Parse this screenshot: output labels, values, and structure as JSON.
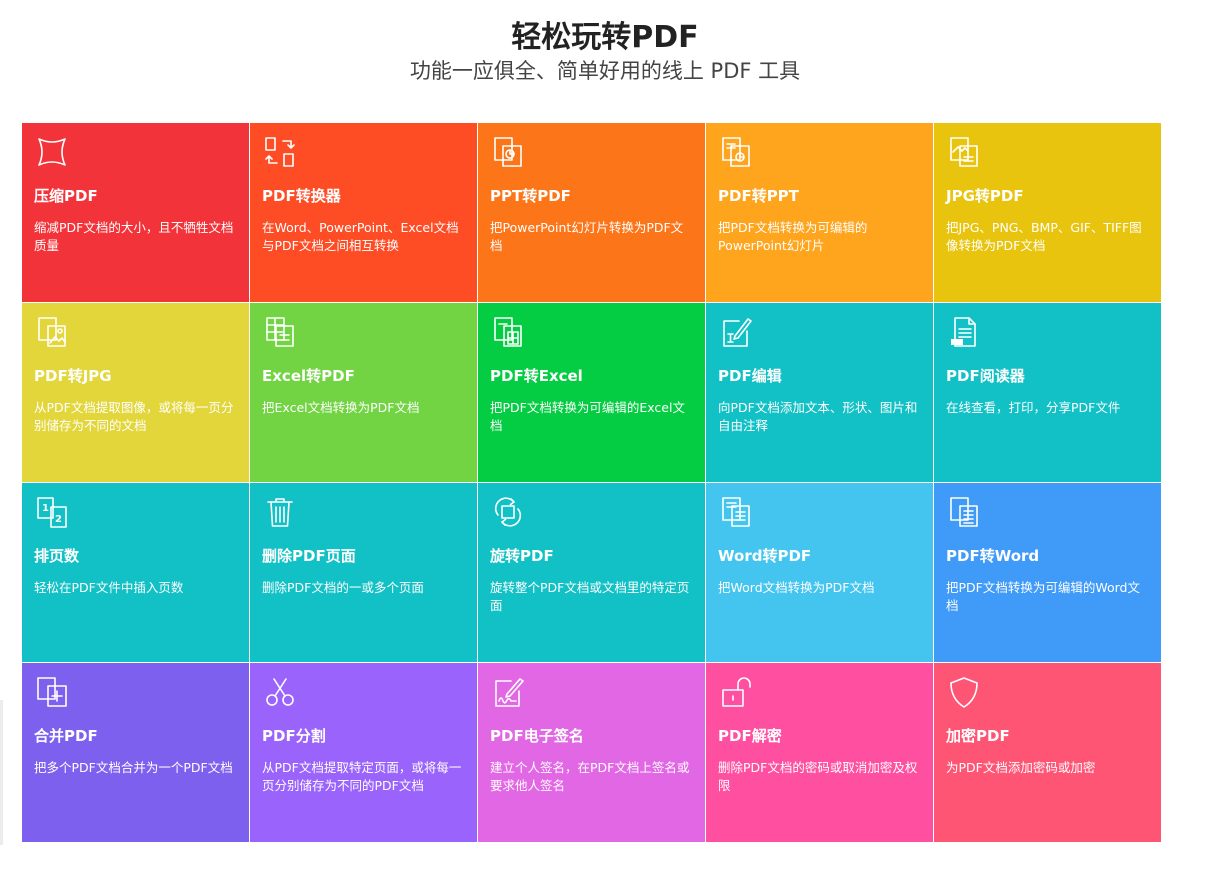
{
  "header": {
    "title": "轻松玩转PDF",
    "subtitle": "功能一应俱全、简单好用的线上 PDF 工具"
  },
  "tools": [
    {
      "title": "压缩PDF",
      "desc": "缩减PDF文档的大小，且不牺牲文档质量",
      "color": "#f2333a",
      "icon": "compress-icon"
    },
    {
      "title": "PDF转换器",
      "desc": "在Word、PowerPoint、Excel文档与PDF文档之间相互转换",
      "color": "#fe4c25",
      "icon": "convert-icon"
    },
    {
      "title": "PPT转PDF",
      "desc": "把PowerPoint幻灯片转换为PDF文档",
      "color": "#fd7519",
      "icon": "ppt-icon"
    },
    {
      "title": "PDF转PPT",
      "desc": "把PDF文档转换为可编辑的PowerPoint幻灯片",
      "color": "#fea41d",
      "icon": "pdf-ppt-icon"
    },
    {
      "title": "JPG转PDF",
      "desc": "把JPG、PNG、BMP、GIF、TIFF图像转换为PDF文档",
      "color": "#e8c40e",
      "icon": "image-icon"
    },
    {
      "title": "PDF转JPG",
      "desc": "从PDF文档提取图像，或将每一页分别储存为不同的文档",
      "color": "#e2d63b",
      "icon": "pdf-image-icon"
    },
    {
      "title": "Excel转PDF",
      "desc": "把Excel文档转换为PDF文档",
      "color": "#72d443",
      "icon": "excel-icon"
    },
    {
      "title": "PDF转Excel",
      "desc": "把PDF文档转换为可编辑的Excel文档",
      "color": "#05cd43",
      "icon": "pdf-excel-icon"
    },
    {
      "title": "PDF编辑",
      "desc": "向PDF文档添加文本、形状、图片和自由注释",
      "color": "#12c1c6",
      "icon": "edit-icon"
    },
    {
      "title": "PDF阅读器",
      "desc": "在线查看，打印，分享PDF文件",
      "color": "#12c1c6",
      "icon": "reader-icon"
    },
    {
      "title": "排页数",
      "desc": "轻松在PDF文件中插入页数",
      "color": "#12c1c6",
      "icon": "page-number-icon"
    },
    {
      "title": "删除PDF页面",
      "desc": "删除PDF文档的一或多个页面",
      "color": "#12c1c6",
      "icon": "trash-icon"
    },
    {
      "title": "旋转PDF",
      "desc": "旋转整个PDF文档或文档里的特定页面",
      "color": "#12c1c6",
      "icon": "rotate-icon"
    },
    {
      "title": "Word转PDF",
      "desc": "把Word文档转换为PDF文档",
      "color": "#43c5ef",
      "icon": "word-icon"
    },
    {
      "title": "PDF转Word",
      "desc": "把PDF文档转换为可编辑的Word文档",
      "color": "#3f9af8",
      "icon": "pdf-word-icon"
    },
    {
      "title": "合并PDF",
      "desc": "把多个PDF文档合并为一个PDF文档",
      "color": "#7e60ef",
      "icon": "merge-icon"
    },
    {
      "title": "PDF分割",
      "desc": "从PDF文档提取特定页面，或将每一页分别储存为不同的PDF文档",
      "color": "#9a63fb",
      "icon": "scissors-icon"
    },
    {
      "title": "PDF电子签名",
      "desc": "建立个人签名，在PDF文档上签名或要求他人签名",
      "color": "#e267e5",
      "icon": "signature-icon"
    },
    {
      "title": "PDF解密",
      "desc": "删除PDF文档的密码或取消加密及权限",
      "color": "#fe4fa0",
      "icon": "unlock-icon"
    },
    {
      "title": "加密PDF",
      "desc": "为PDF文档添加密码或加密",
      "color": "#fe5575",
      "icon": "shield-icon"
    }
  ]
}
